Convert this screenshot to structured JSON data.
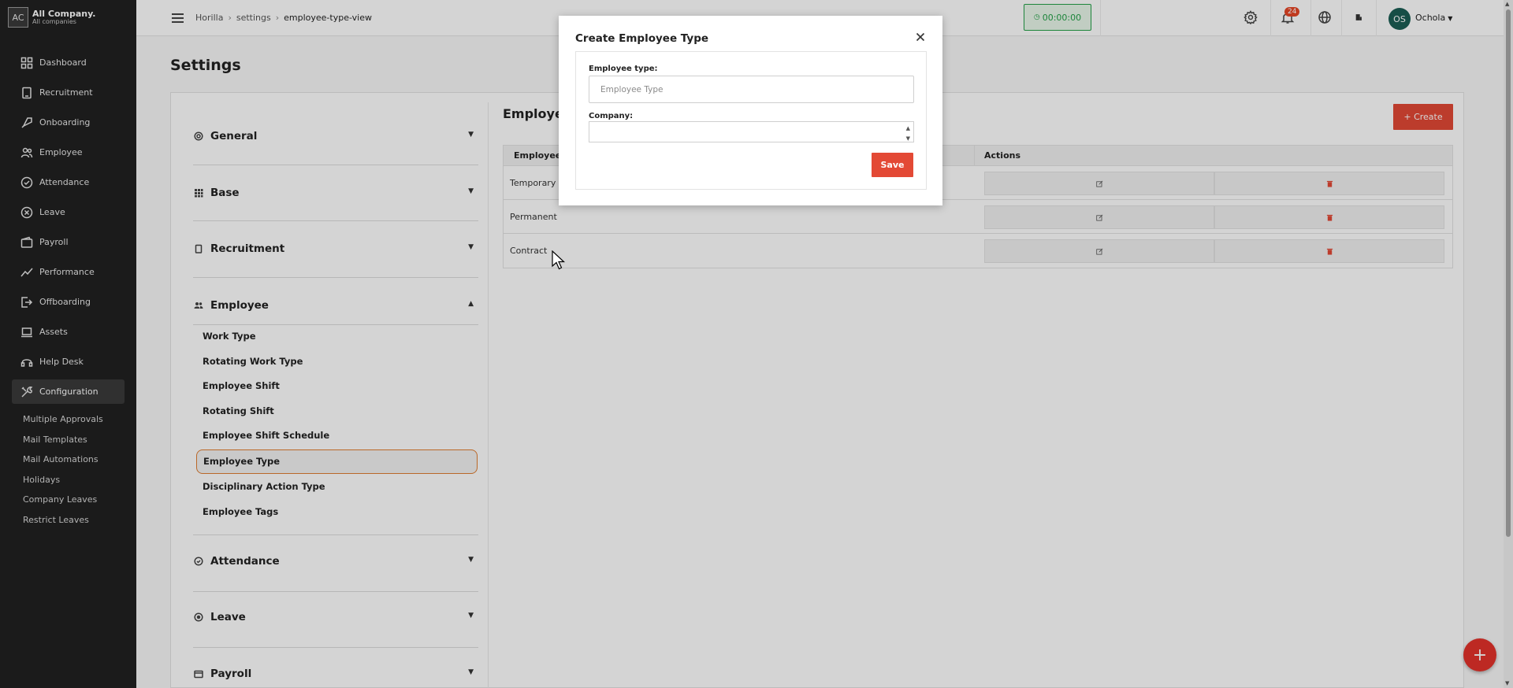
{
  "sidebar": {
    "company_logo": "AC",
    "company_name": "All Company.",
    "company_sub": "All companies",
    "items": [
      {
        "label": "Dashboard",
        "icon": "dashboard-icon"
      },
      {
        "label": "Recruitment",
        "icon": "recruitment-icon"
      },
      {
        "label": "Onboarding",
        "icon": "rocket-icon"
      },
      {
        "label": "Employee",
        "icon": "people-icon"
      },
      {
        "label": "Attendance",
        "icon": "check-circle-icon"
      },
      {
        "label": "Leave",
        "icon": "x-circle-icon"
      },
      {
        "label": "Payroll",
        "icon": "wallet-icon"
      },
      {
        "label": "Performance",
        "icon": "trend-icon"
      },
      {
        "label": "Offboarding",
        "icon": "exit-icon"
      },
      {
        "label": "Assets",
        "icon": "laptop-icon"
      },
      {
        "label": "Help Desk",
        "icon": "headset-icon"
      },
      {
        "label": "Configuration",
        "icon": "tools-icon"
      }
    ],
    "sub_items": [
      "Multiple Approvals",
      "Mail Templates",
      "Mail Automations",
      "Holidays",
      "Company Leaves",
      "Restrict Leaves"
    ]
  },
  "header": {
    "breadcrumb": [
      "Horilla",
      "settings",
      "employee-type-view"
    ],
    "timer": "00:00:00",
    "notification_count": "24",
    "avatar_initials": "OS",
    "username": "Ochola"
  },
  "page": {
    "title": "Settings",
    "accordion": {
      "general": "General",
      "base": "Base",
      "recruitment": "Recruitment",
      "employee": "Employee",
      "attendance": "Attendance",
      "leave": "Leave",
      "payroll": "Payroll"
    },
    "employee_sub": [
      "Work Type",
      "Rotating Work Type",
      "Employee Shift",
      "Rotating Shift",
      "Employee Shift Schedule",
      "Employee Type",
      "Disciplinary Action Type",
      "Employee Tags"
    ],
    "active_sub": "Employee Type"
  },
  "content": {
    "title": "Employee",
    "create_label": "+ Create",
    "columns": [
      "Employee Ty",
      "Actions"
    ],
    "rows": [
      "Temporary",
      "Permanent",
      "Contract"
    ]
  },
  "modal": {
    "title": "Create Employee Type",
    "employee_type_label": "Employee type:",
    "employee_type_placeholder": "Employee Type",
    "company_label": "Company:",
    "save_label": "Save"
  },
  "fab_label": "+",
  "colors": {
    "accent": "#e34935",
    "sidebar_bg": "#212121",
    "timer_green": "#24a148",
    "active_border": "#e07d31"
  }
}
